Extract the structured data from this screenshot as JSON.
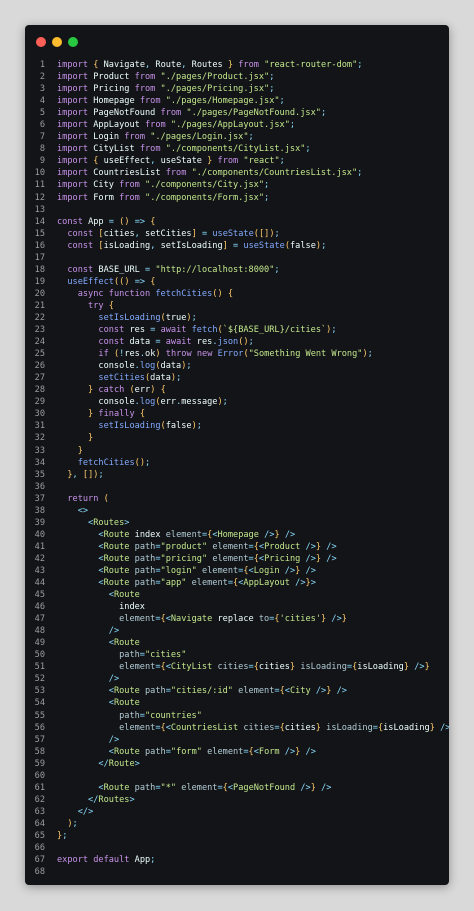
{
  "window": {
    "controls": [
      "close",
      "minimize",
      "maximize"
    ]
  },
  "code_lines": [
    {
      "n": "1",
      "text": "import { Navigate, Route, Routes } from \"react-router-dom\";"
    },
    {
      "n": "2",
      "text": "import Product from \"./pages/Product.jsx\";"
    },
    {
      "n": "3",
      "text": "import Pricing from \"./pages/Pricing.jsx\";"
    },
    {
      "n": "4",
      "text": "import Homepage from \"./pages/Homepage.jsx\";"
    },
    {
      "n": "5",
      "text": "import PageNotFound from \"./pages/PageNotFound.jsx\";"
    },
    {
      "n": "6",
      "text": "import AppLayout from \"./pages/AppLayout.jsx\";"
    },
    {
      "n": "7",
      "text": "import Login from \"./pages/Login.jsx\";"
    },
    {
      "n": "8",
      "text": "import CityList from \"./components/CityList.jsx\";"
    },
    {
      "n": "9",
      "text": "import { useEffect, useState } from \"react\";"
    },
    {
      "n": "10",
      "text": "import CountriesList from \"./components/CountriesList.jsx\";"
    },
    {
      "n": "11",
      "text": "import City from \"./components/City.jsx\";"
    },
    {
      "n": "12",
      "text": "import Form from \"./components/Form.jsx\";"
    },
    {
      "n": "13",
      "text": ""
    },
    {
      "n": "14",
      "text": "const App = () => {"
    },
    {
      "n": "15",
      "text": "  const [cities, setCities] = useState([]);"
    },
    {
      "n": "16",
      "text": "  const [isLoading, setIsLoading] = useState(false);"
    },
    {
      "n": "17",
      "text": ""
    },
    {
      "n": "18",
      "text": "  const BASE_URL = \"http://localhost:8000\";"
    },
    {
      "n": "19",
      "text": "  useEffect(() => {"
    },
    {
      "n": "20",
      "text": "    async function fetchCities() {"
    },
    {
      "n": "21",
      "text": "      try {"
    },
    {
      "n": "22",
      "text": "        setIsLoading(true);"
    },
    {
      "n": "23",
      "text": "        const res = await fetch(`${BASE_URL}/cities`);"
    },
    {
      "n": "24",
      "text": "        const data = await res.json();"
    },
    {
      "n": "25",
      "text": "        if (!res.ok) throw new Error(\"Something Went Wrong\");"
    },
    {
      "n": "26",
      "text": "        console.log(data);"
    },
    {
      "n": "27",
      "text": "        setCities(data);"
    },
    {
      "n": "28",
      "text": "      } catch (err) {"
    },
    {
      "n": "29",
      "text": "        console.log(err.message);"
    },
    {
      "n": "30",
      "text": "      } finally {"
    },
    {
      "n": "31",
      "text": "        setIsLoading(false);"
    },
    {
      "n": "32",
      "text": "      }"
    },
    {
      "n": "33",
      "text": "    }"
    },
    {
      "n": "34",
      "text": "    fetchCities();"
    },
    {
      "n": "35",
      "text": "  }, []);"
    },
    {
      "n": "36",
      "text": ""
    },
    {
      "n": "37",
      "text": "  return ("
    },
    {
      "n": "38",
      "text": "    <>"
    },
    {
      "n": "39",
      "text": "      <Routes>"
    },
    {
      "n": "40",
      "text": "        <Route index element={<Homepage />} />"
    },
    {
      "n": "41",
      "text": "        <Route path=\"product\" element={<Product />} />"
    },
    {
      "n": "42",
      "text": "        <Route path=\"pricing\" element={<Pricing />} />"
    },
    {
      "n": "43",
      "text": "        <Route path=\"login\" element={<Login />} />"
    },
    {
      "n": "44",
      "text": "        <Route path=\"app\" element={<AppLayout />}>"
    },
    {
      "n": "45",
      "text": "          <Route"
    },
    {
      "n": "46",
      "text": "            index"
    },
    {
      "n": "47",
      "text": "            element={<Navigate replace to={'cities'} />}"
    },
    {
      "n": "48",
      "text": "          />"
    },
    {
      "n": "49",
      "text": "          <Route"
    },
    {
      "n": "50",
      "text": "            path=\"cities\""
    },
    {
      "n": "51",
      "text": "            element={<CityList cities={cities} isLoading={isLoading} />}"
    },
    {
      "n": "52",
      "text": "          />"
    },
    {
      "n": "53",
      "text": "          <Route path=\"cities/:id\" element={<City />} />"
    },
    {
      "n": "54",
      "text": "          <Route"
    },
    {
      "n": "55",
      "text": "            path=\"countries\""
    },
    {
      "n": "56",
      "text": "            element={<CountriesList cities={cities} isLoading={isLoading} />}"
    },
    {
      "n": "57",
      "text": "          />"
    },
    {
      "n": "58",
      "text": "          <Route path=\"form\" element={<Form />} />"
    },
    {
      "n": "59",
      "text": "        </Route>"
    },
    {
      "n": "60",
      "text": ""
    },
    {
      "n": "61",
      "text": "        <Route path=\"*\" element={<PageNotFound />} />"
    },
    {
      "n": "62",
      "text": "      </Routes>"
    },
    {
      "n": "63",
      "text": "    </>"
    },
    {
      "n": "64",
      "text": "  );"
    },
    {
      "n": "65",
      "text": "};"
    },
    {
      "n": "66",
      "text": ""
    },
    {
      "n": "67",
      "text": "export default App;"
    },
    {
      "n": "68",
      "text": ""
    }
  ],
  "theme": {
    "window_bg": "#131417",
    "page_bg": "#d9d9d9",
    "line_number": "#9a9ca4",
    "keyword": "#c792ea",
    "string": "#c3e88d",
    "function": "#82aaff",
    "tag": "#c3e88d",
    "bracket": "#ffcb6b",
    "punctuation": "#89ddff",
    "control_red": "#fe5f57",
    "control_yellow": "#febc2e",
    "control_green": "#28c840"
  }
}
